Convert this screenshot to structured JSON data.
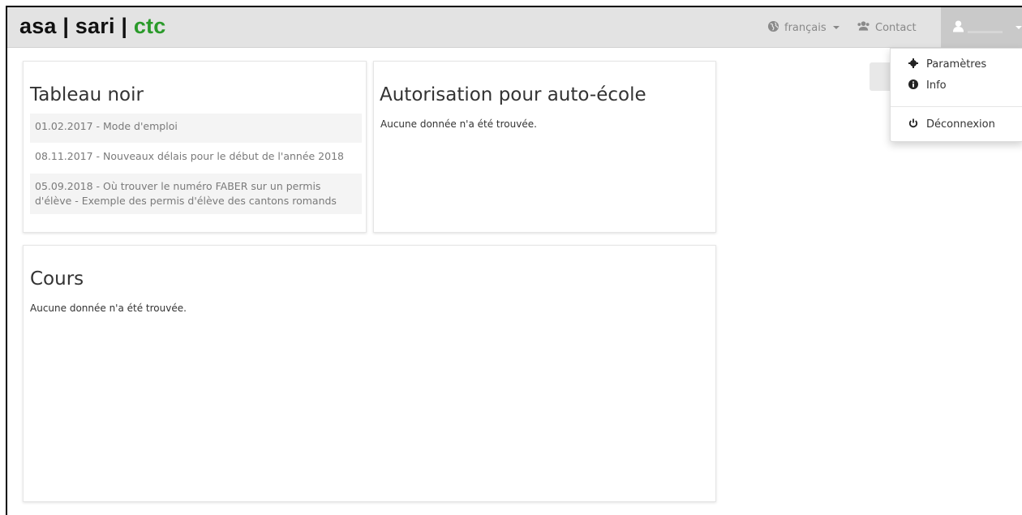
{
  "brand": {
    "part1": "asa | sari | ",
    "part2": "ctc"
  },
  "navbar": {
    "language_label": "français",
    "contact_label": "Contact"
  },
  "user_menu": {
    "items": [
      {
        "label": "Paramètres",
        "icon": "gear-icon"
      },
      {
        "label": "Info",
        "icon": "info-icon"
      },
      {
        "label": "Déconnexion",
        "icon": "power-icon"
      }
    ]
  },
  "blackboard": {
    "title": "Tableau noir",
    "items": [
      "01.02.2017 - Mode d'emploi",
      "08.11.2017 - Nouveaux délais pour le début de l'année 2018",
      "05.09.2018 - Où trouver le numéro FABER sur un permis d'élève - Exemple des permis d'élève des cantons romands"
    ]
  },
  "authorization": {
    "title": "Autorisation pour auto-école",
    "empty_text": "Aucune donnée n'a été trouvée."
  },
  "courses": {
    "title": "Cours",
    "empty_text": "Aucune donnée n'a été trouvée."
  },
  "colors": {
    "brand_green": "#2a9a2a",
    "navbar_bg": "#e3e3e3"
  }
}
